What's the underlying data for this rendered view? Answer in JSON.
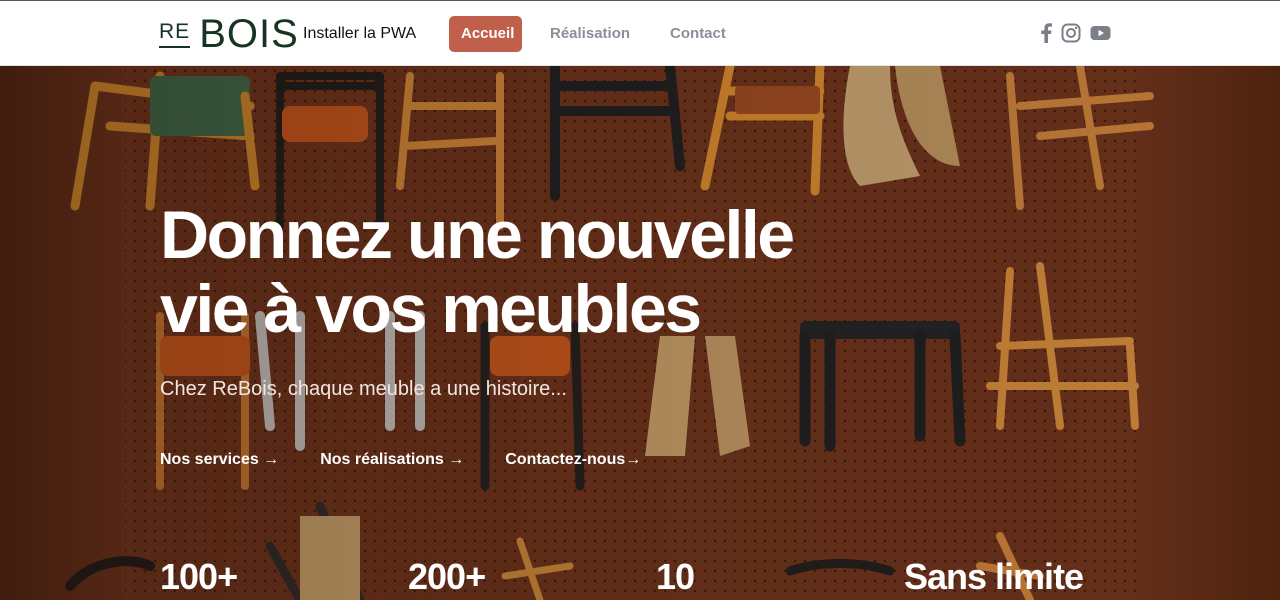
{
  "header": {
    "logo_re": "RE",
    "logo_bois": "BOIS",
    "install_pwa": "Installer la PWA",
    "nav": [
      {
        "label": "Accueil",
        "active": true
      },
      {
        "label": "Réalisation",
        "active": false
      },
      {
        "label": "Contact",
        "active": false
      }
    ],
    "social": [
      "facebook-icon",
      "instagram-icon",
      "youtube-icon"
    ],
    "active_color": "#c0604a",
    "brand_color": "#173321"
  },
  "hero": {
    "title_line1": "Donnez une nouvelle",
    "title_line2": "vie à vos meubles",
    "subtitle": "Chez ReBois, chaque meuble a une histoire...",
    "links": [
      {
        "label": "Nos services →"
      },
      {
        "label": "Nos réalisations →"
      },
      {
        "label": "Contactez-nous→"
      }
    ],
    "stats": [
      "100+",
      "200+",
      "10",
      "Sans limite"
    ]
  }
}
